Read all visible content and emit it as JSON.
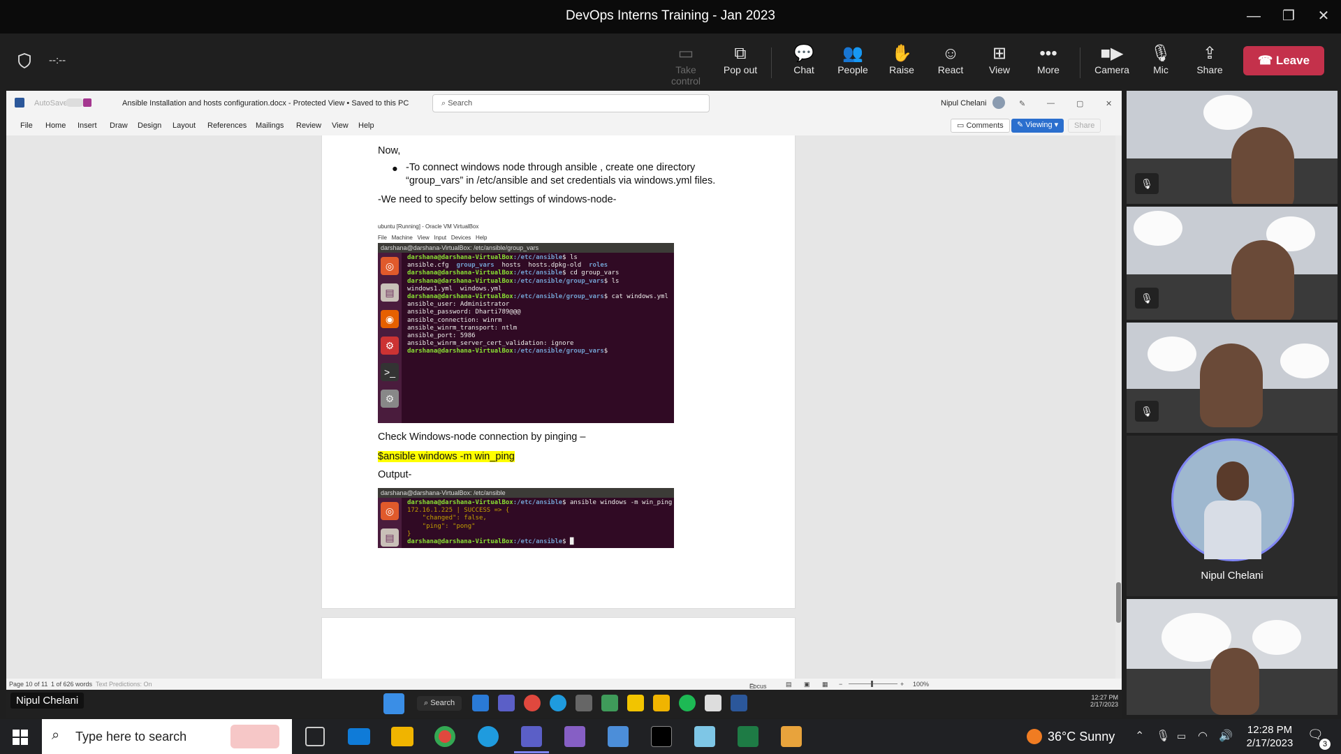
{
  "window": {
    "title": "DevOps Interns Training - Jan 2023",
    "minimize": "—",
    "restore": "❐",
    "close": "✕"
  },
  "toolbar": {
    "timer": "--:--",
    "take_control": "Take control",
    "pop_out": "Pop out",
    "chat": "Chat",
    "people": "People",
    "raise": "Raise",
    "react": "React",
    "view": "View",
    "more": "More",
    "camera": "Camera",
    "mic": "Mic",
    "share": "Share",
    "leave": "Leave"
  },
  "word": {
    "autosave": "AutoSave",
    "doc_title": "Ansible Installation and hosts configuration.docx  -  Protected View  •  Saved to this PC",
    "search_placeholder": "Search",
    "user": "Nipul Chelani",
    "menu": [
      "File",
      "Home",
      "Insert",
      "Draw",
      "Design",
      "Layout",
      "References",
      "Mailings",
      "Review",
      "View",
      "Help"
    ],
    "comments": "Comments",
    "viewing": "Viewing",
    "share": "Share"
  },
  "document": {
    "now": "Now,",
    "bullet": "-To connect windows node through ansible , create one directory",
    "bullet_cont": "“group_vars” in /etc/ansible and set credentials via windows.yml files.",
    "settings_intro": "-We need to specify below settings of windows-node-",
    "vbox_title": "ubuntu [Running] - Oracle VM VirtualBox",
    "vbox_menu": [
      "File",
      "Machine",
      "View",
      "Input",
      "Devices",
      "Help"
    ],
    "term1_head": "darshana@darshana-VirtualBox: /etc/ansible/group_vars",
    "check": "Check Windows-node connection by pinging –",
    "command": "$ansible windows -m win_ping",
    "output": "Output-",
    "term2_head": "darshana@darshana-VirtualBox: /etc/ansible"
  },
  "terminal1": [
    {
      "prompt": "darshana@darshana-VirtualBox",
      "path": ":/etc/ansible",
      "cmd": "$ ls"
    },
    {
      "text": "ansible.cfg  ",
      "blue": "group_vars",
      "rest": "  hosts  hosts.dpkg-old  ",
      "blue2": "roles"
    },
    {
      "prompt": "darshana@darshana-VirtualBox",
      "path": ":/etc/ansible",
      "cmd": "$ cd group_vars"
    },
    {
      "prompt": "darshana@darshana-VirtualBox",
      "path": ":/etc/ansible/group_vars",
      "cmd": "$ ls"
    },
    {
      "text": "windows1.yml  windows.yml"
    },
    {
      "prompt": "darshana@darshana-VirtualBox",
      "path": ":/etc/ansible/group_vars",
      "cmd": "$ cat windows.yml"
    },
    {
      "text": "ansible_user: Administrator"
    },
    {
      "text": "ansible_password: Dharti789@@@"
    },
    {
      "text": "ansible_connection: winrm"
    },
    {
      "text": "ansible_winrm_transport: ntlm"
    },
    {
      "text": "ansible_port: 5986"
    },
    {
      "text": "ansible_winrm_server_cert_validation: ignore"
    },
    {
      "prompt": "darshana@darshana-VirtualBox",
      "path": ":/etc/ansible/group_vars",
      "cmd": "$"
    }
  ],
  "terminal2": [
    {
      "prompt": "darshana@darshana-VirtualBox",
      "path": ":/etc/ansible",
      "cmd": "$ ansible windows -m win_ping"
    },
    {
      "yellow": "172.16.1.225 | SUCCESS => {"
    },
    {
      "yellow": "    \"changed\": false,"
    },
    {
      "yellow": "    \"ping\": \"pong\""
    },
    {
      "yellow": "}"
    },
    {
      "prompt": "darshana@darshana-VirtualBox",
      "path": ":/etc/ansible",
      "cmd": "$ █"
    }
  ],
  "statusbar": {
    "page": "Page 10 of 11",
    "words": "1 of 626 words",
    "predictions": "Text Predictions: On",
    "focus": "Focus",
    "zoom": "100%"
  },
  "participants": {
    "featured_name": "Nipul Chelani",
    "presenter_label": "Nipul Chelani"
  },
  "inner_taskbar": {
    "search": "Search",
    "time": "12:27 PM",
    "date": "2/17/2023"
  },
  "outer_taskbar": {
    "search_placeholder": "Type here to search",
    "weather": "36°C  Sunny",
    "time": "12:28 PM",
    "date": "2/17/2023",
    "notifications": "3"
  }
}
